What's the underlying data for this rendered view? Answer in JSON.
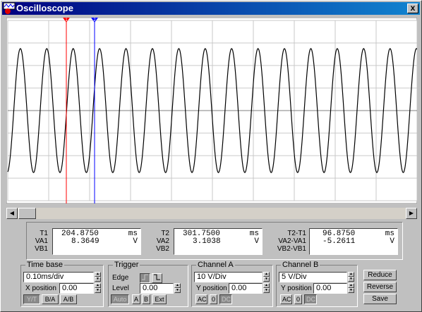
{
  "window": {
    "title": "Oscilloscope",
    "close_glyph": "x"
  },
  "cursors": {
    "t1_label": "1",
    "t2_label": "2"
  },
  "readouts": {
    "col1": {
      "t_label": "T1",
      "va_label": "VA1",
      "vb_label": "VB1",
      "t_value": "204.8750",
      "t_unit": "ms",
      "va_value": "8.3649",
      "va_unit": "V",
      "vb_value": "",
      "vb_unit": ""
    },
    "col2": {
      "t_label": "T2",
      "va_label": "VA2",
      "vb_label": "VB2",
      "t_value": "301.7500",
      "t_unit": "ms",
      "va_value": "3.1038",
      "va_unit": "V",
      "vb_value": "",
      "vb_unit": ""
    },
    "col3": {
      "t_label": "T2-T1",
      "va_label": "VA2-VA1",
      "vb_label": "VB2-VB1",
      "t_value": "96.8750",
      "t_unit": "ms",
      "va_value": "-5.2611",
      "va_unit": "V",
      "vb_value": "",
      "vb_unit": ""
    }
  },
  "timebase": {
    "title": "Time base",
    "value": "0.10ms/div",
    "xpos_label": "X position",
    "xpos_value": "0.00",
    "modes": [
      "Y/T",
      "B/A",
      "A/B"
    ]
  },
  "trigger": {
    "title": "Trigger",
    "edge_label": "Edge",
    "level_label": "Level",
    "level_value": "0.00",
    "sources": [
      "Auto",
      "A",
      "B",
      "Ext"
    ]
  },
  "channel_a": {
    "title": "Channel A",
    "scale": "10 V/Div",
    "ypos_label": "Y position",
    "ypos_value": "0.00",
    "coupling": [
      "AC",
      "0",
      "DC"
    ]
  },
  "channel_b": {
    "title": "Channel B",
    "scale": "5 V/Div",
    "ypos_label": "Y position",
    "ypos_value": "0.00",
    "coupling": [
      "AC",
      "0",
      "DC"
    ]
  },
  "buttons": {
    "reduce": "Reduce",
    "reverse": "Reverse",
    "save": "Save"
  },
  "signal": {
    "cycles_per_div": 1.55,
    "amplitude_div": 2.75,
    "trace_color": "#000000",
    "cursor1_color": "#ff0000",
    "cursor2_color": "#0000ff",
    "grid_color": "#c8c8c8"
  }
}
